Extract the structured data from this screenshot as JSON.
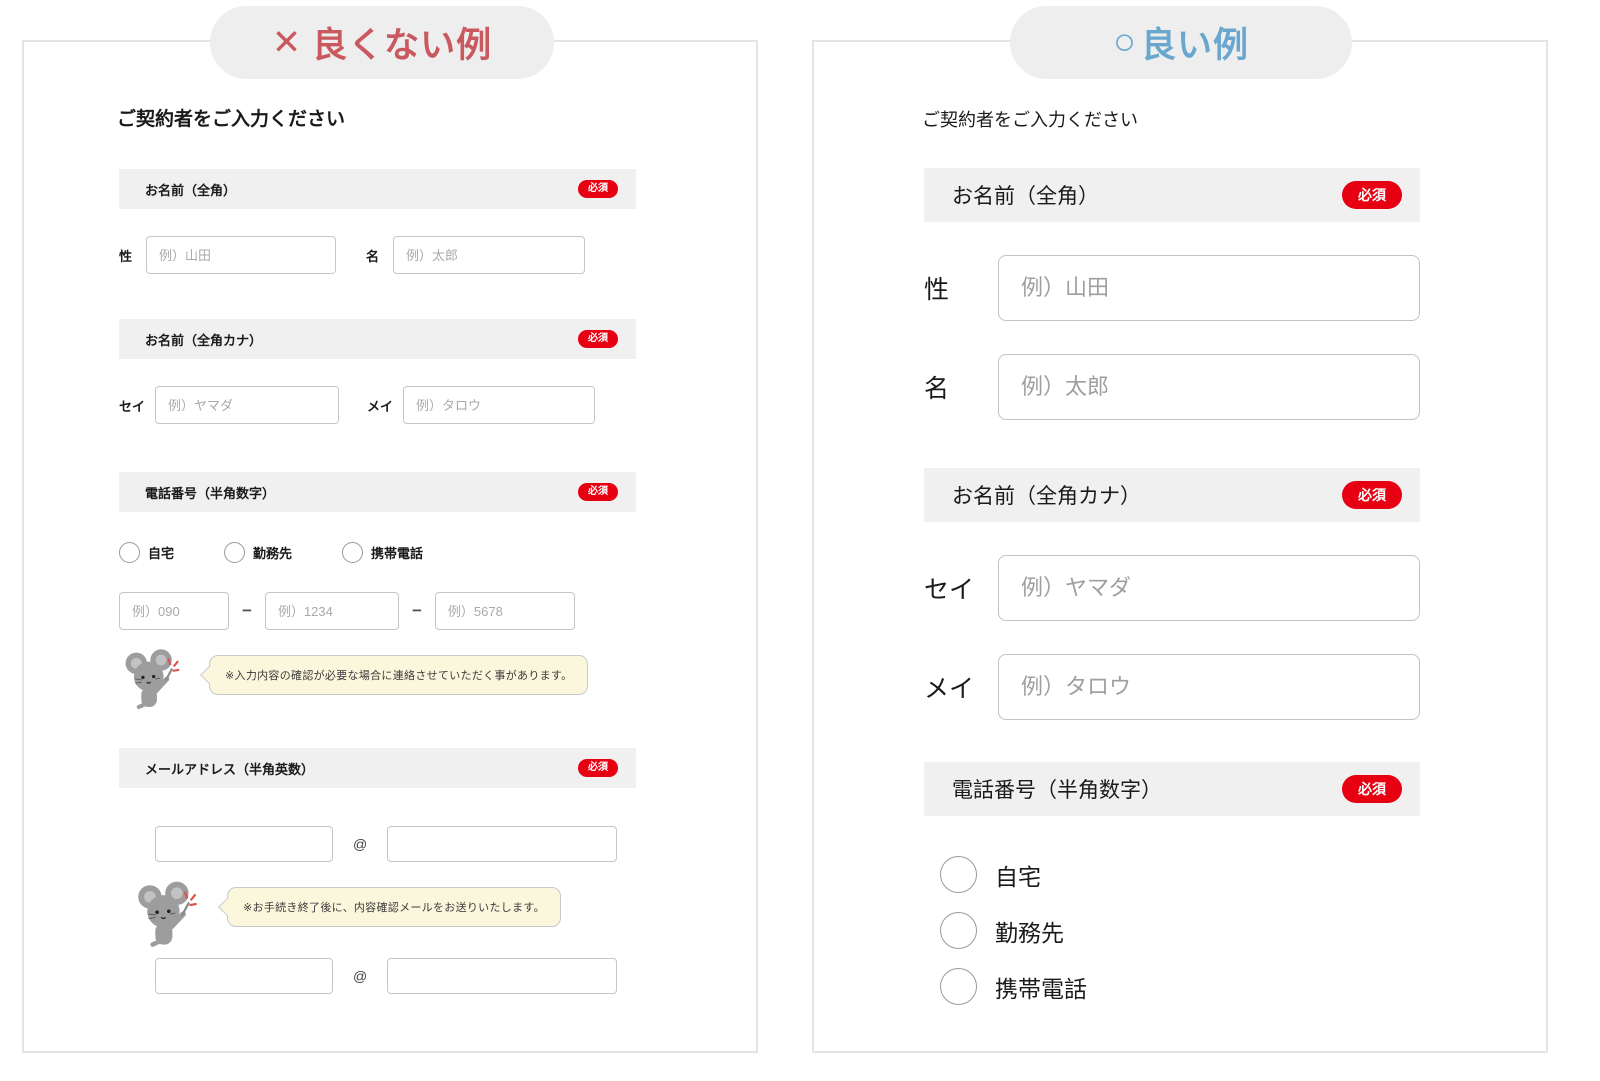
{
  "colors": {
    "required_badge_bg": "#e60012",
    "bad_accent": "#c9595e",
    "good_accent": "#69a7cf",
    "section_bar_bg": "#f0f0f0",
    "bubble_bg": "#fbf7dc"
  },
  "required_badge": "必須",
  "bad": {
    "header": {
      "icon": "✕",
      "label": "良くない例"
    },
    "title": "ご契約者をご入力ください",
    "name_section": "お名前（全角）",
    "name_fields": {
      "last_label": "性",
      "last_placeholder": "例）山田",
      "first_label": "名",
      "first_placeholder": "例）太郎"
    },
    "kana_section": "お名前（全角カナ）",
    "kana_fields": {
      "last_label": "セイ",
      "last_placeholder": "例）ヤマダ",
      "first_label": "メイ",
      "first_placeholder": "例）タロウ"
    },
    "phone_section": "電話番号（半角数字）",
    "phone_types": [
      "自宅",
      "勤務先",
      "携帯電話"
    ],
    "phone_placeholders": [
      "例）090",
      "例）1234",
      "例）5678"
    ],
    "phone_separator": "−",
    "phone_note": "※入力内容の確認が必要な場合に連絡させていただく事があります。",
    "email_section": "メールアドレス（半角英数）",
    "email_at": "@",
    "email_note": "※お手続き終了後に、内容確認メールをお送りいたします。"
  },
  "good": {
    "header": {
      "icon": "○",
      "label": "良い例"
    },
    "title": "ご契約者をご入力ください",
    "name_section": "お名前（全角）",
    "name_fields": {
      "last_label": "性",
      "last_placeholder": "例）山田",
      "first_label": "名",
      "first_placeholder": "例）太郎"
    },
    "kana_section": "お名前（全角カナ）",
    "kana_fields": {
      "last_label": "セイ",
      "last_placeholder": "例）ヤマダ",
      "first_label": "メイ",
      "first_placeholder": "例）タロウ"
    },
    "phone_section": "電話番号（半角数字）",
    "phone_types": [
      "自宅",
      "勤務先",
      "携帯電話"
    ]
  }
}
